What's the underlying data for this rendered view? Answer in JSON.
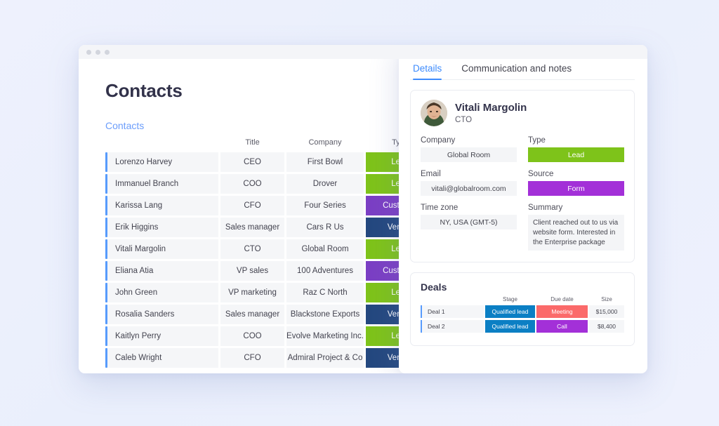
{
  "window": {
    "dots": [
      "close-dot",
      "minimize-dot",
      "maximize-dot"
    ]
  },
  "board": {
    "page_title": "Contacts",
    "group_title": "Contacts",
    "columns": [
      "",
      "Title",
      "Company",
      "Type"
    ],
    "rows": [
      {
        "name": "Lorenzo Harvey",
        "title": "CEO",
        "company": "First Bowl",
        "type": "Lead",
        "type_class": "type-lead"
      },
      {
        "name": "Immanuel Branch",
        "title": "COO",
        "company": "Drover",
        "type": "Lead",
        "type_class": "type-lead"
      },
      {
        "name": "Karissa Lang",
        "title": "CFO",
        "company": "Four Series",
        "type": "Customer",
        "type_class": "type-customer"
      },
      {
        "name": "Erik Higgins",
        "title": "Sales manager",
        "company": "Cars R Us",
        "type": "Vendor",
        "type_class": "type-vendor"
      },
      {
        "name": "Vitali Margolin",
        "title": "CTO",
        "company": "Global Room",
        "type": "Lead",
        "type_class": "type-lead"
      },
      {
        "name": "Eliana Atia",
        "title": "VP sales",
        "company": "100 Adventures",
        "type": "Customer",
        "type_class": "type-customer"
      },
      {
        "name": "John Green",
        "title": "VP marketing",
        "company": "Raz C North",
        "type": "Lead",
        "type_class": "type-lead"
      },
      {
        "name": "Rosalia Sanders",
        "title": "Sales manager",
        "company": "Blackstone Exports",
        "type": "Vendor",
        "type_class": "type-vendor"
      },
      {
        "name": "Kaitlyn Perry",
        "title": "COO",
        "company": "Evolve Marketing Inc.",
        "type": "Lead",
        "type_class": "type-lead"
      },
      {
        "name": "Caleb Wright",
        "title": "CFO",
        "company": "Admiral Project & Co",
        "type": "Vendor",
        "type_class": "type-vendor"
      }
    ]
  },
  "details": {
    "tabs": [
      {
        "label": "Details",
        "active": true
      },
      {
        "label": "Communication and notes",
        "active": false
      }
    ],
    "profile": {
      "name": "Vitali Margolin",
      "role": "CTO",
      "avatar": "contact-photo"
    },
    "fields": [
      {
        "label": "Company",
        "value": "Global Room"
      },
      {
        "label": "Type",
        "value": "Lead",
        "style": "pill-lead"
      },
      {
        "label": "Email",
        "value": "vitali@globalroom.com"
      },
      {
        "label": "Source",
        "value": "Form",
        "style": "pill-form"
      },
      {
        "label": "Time zone",
        "value": "NY, USA (GMT-5)"
      },
      {
        "label": "Summary",
        "value": "Client reached out to us via website form. Interested in the Enterprise package",
        "style": "multiline"
      }
    ]
  },
  "deals": {
    "title": "Deals",
    "columns": [
      "",
      "Stage",
      "Due date",
      "Size"
    ],
    "rows": [
      {
        "name": "Deal 1",
        "stage": "Qualified lead",
        "stage_class": "st-qualified",
        "due": "Meeting",
        "due_class": "st-meeting",
        "size": "$15,000"
      },
      {
        "name": "Deal 2",
        "stage": "Qualified lead",
        "stage_class": "st-qualified",
        "due": "Call",
        "due_class": "st-call",
        "size": "$8,400"
      }
    ]
  },
  "colors": {
    "background": "#eef1fd",
    "accent_blue": "#579bfc",
    "tab_blue": "#3d8bfd",
    "lead_green": "#7ec31a",
    "customer_purple": "#7b3fc4",
    "vendor_navy": "#24487f",
    "form_purple": "#a330d8",
    "stage_blue": "#0b7fc4",
    "meeting_red": "#fb6a6a",
    "cell_gray": "#f5f6f8"
  }
}
